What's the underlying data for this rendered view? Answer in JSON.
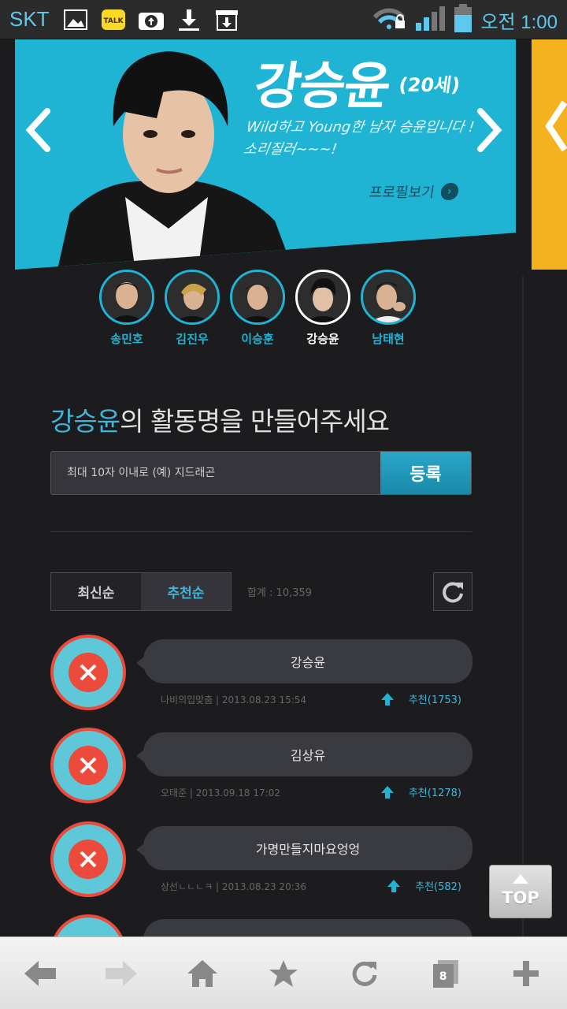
{
  "status_bar": {
    "carrier": "SKT",
    "time": "오전 1:00"
  },
  "banner": {
    "name": "강승윤",
    "age": "(20세)",
    "desc_line1": "Wild하고 Young한 남자 승윤입니다 !",
    "desc_line2": "소리질러~~~!",
    "profile_link": "프로필보기",
    "color": "#1fb3d4",
    "next_color": "#f4b21f"
  },
  "members": [
    {
      "name": "송민호"
    },
    {
      "name": "김진우"
    },
    {
      "name": "이승훈"
    },
    {
      "name": "강승윤"
    },
    {
      "name": "남태현"
    }
  ],
  "nickname": {
    "title_highlight": "강승윤",
    "title_rest": "의 활동명을 만들어주세요",
    "placeholder": "최대 10자 이내로 (예) 지드래곤",
    "submit_label": "등록"
  },
  "sort": {
    "latest": "최신순",
    "recommended": "추천순",
    "total": "합계 : 10,359"
  },
  "list": [
    {
      "text": "강승윤",
      "meta": "나비의입맞춤  |  2013.08.23 15:54",
      "rec": "추천(1753)"
    },
    {
      "text": "김상유",
      "meta": "오태준  |  2013.09.18 17:02",
      "rec": "추천(1278)"
    },
    {
      "text": "가명만들지마요엉엉",
      "meta": "상선ㄴㄴㄴㅋ  |  2013.08.23 20:36",
      "rec": "추천(582)"
    }
  ],
  "top_button": "TOP",
  "browser": {
    "tab_count": "8"
  },
  "colors": {
    "accent": "#1fb3d4",
    "background": "#1c1c1f",
    "badge_red": "#ec4a3a"
  }
}
